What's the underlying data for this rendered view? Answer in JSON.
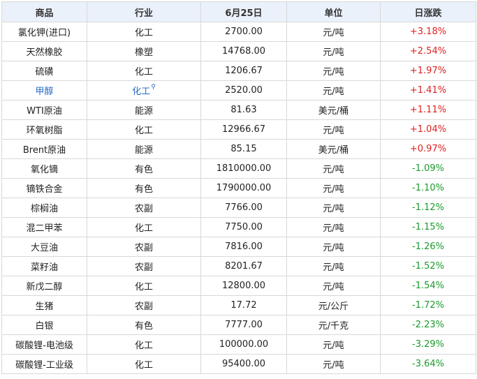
{
  "header": {
    "product": "商品",
    "industry": "行业",
    "date": "6月25日",
    "unit": "单位",
    "change": "日涨跌"
  },
  "colors": {
    "up": "#e02020",
    "down": "#1a9a2a",
    "link": "#2a6bc4",
    "header_bg": "#eaf1fb"
  },
  "rows": [
    {
      "product": "氯化钾(进口)",
      "industry": "化工",
      "price": "2700.00",
      "unit": "元/吨",
      "change": "+3.18%",
      "dir": "up"
    },
    {
      "product": "天然橡胶",
      "industry": "橡塑",
      "price": "14768.00",
      "unit": "元/吨",
      "change": "+2.54%",
      "dir": "up"
    },
    {
      "product": "硫磺",
      "industry": "化工",
      "price": "1206.67",
      "unit": "元/吨",
      "change": "+1.97%",
      "dir": "up"
    },
    {
      "product": "甲醇",
      "industry": "化工",
      "price": "2520.00",
      "unit": "元/吨",
      "change": "+1.41%",
      "dir": "up",
      "linked": true
    },
    {
      "product": "WTI原油",
      "industry": "能源",
      "price": "81.63",
      "unit": "美元/桶",
      "change": "+1.11%",
      "dir": "up"
    },
    {
      "product": "环氧树脂",
      "industry": "化工",
      "price": "12966.67",
      "unit": "元/吨",
      "change": "+1.04%",
      "dir": "up"
    },
    {
      "product": "Brent原油",
      "industry": "能源",
      "price": "85.15",
      "unit": "美元/桶",
      "change": "+0.97%",
      "dir": "up"
    },
    {
      "product": "氧化镝",
      "industry": "有色",
      "price": "1810000.00",
      "unit": "元/吨",
      "change": "-1.09%",
      "dir": "down"
    },
    {
      "product": "镝铁合金",
      "industry": "有色",
      "price": "1790000.00",
      "unit": "元/吨",
      "change": "-1.10%",
      "dir": "down"
    },
    {
      "product": "棕榈油",
      "industry": "农副",
      "price": "7766.00",
      "unit": "元/吨",
      "change": "-1.12%",
      "dir": "down"
    },
    {
      "product": "混二甲苯",
      "industry": "化工",
      "price": "7750.00",
      "unit": "元/吨",
      "change": "-1.15%",
      "dir": "down"
    },
    {
      "product": "大豆油",
      "industry": "农副",
      "price": "7816.00",
      "unit": "元/吨",
      "change": "-1.26%",
      "dir": "down"
    },
    {
      "product": "菜籽油",
      "industry": "农副",
      "price": "8201.67",
      "unit": "元/吨",
      "change": "-1.52%",
      "dir": "down"
    },
    {
      "product": "新戊二醇",
      "industry": "化工",
      "price": "12800.00",
      "unit": "元/吨",
      "change": "-1.54%",
      "dir": "down"
    },
    {
      "product": "生猪",
      "industry": "农副",
      "price": "17.72",
      "unit": "元/公斤",
      "change": "-1.72%",
      "dir": "down"
    },
    {
      "product": "白银",
      "industry": "有色",
      "price": "7777.00",
      "unit": "元/千克",
      "change": "-2.23%",
      "dir": "down"
    },
    {
      "product": "碳酸锂-电池级",
      "industry": "化工",
      "price": "100000.00",
      "unit": "元/吨",
      "change": "-3.29%",
      "dir": "down"
    },
    {
      "product": "碳酸锂-工业级",
      "industry": "化工",
      "price": "95400.00",
      "unit": "元/吨",
      "change": "-3.64%",
      "dir": "down"
    }
  ]
}
